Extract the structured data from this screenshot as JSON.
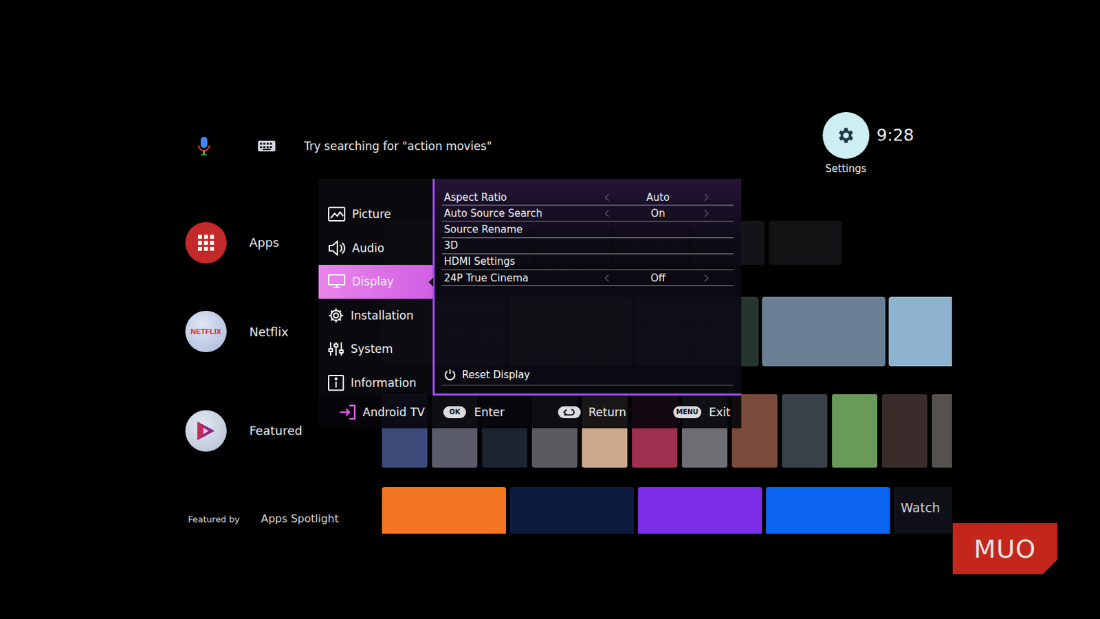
{
  "search": {
    "hint": "Try searching for \"action movies\""
  },
  "settings_button": {
    "label": "Settings"
  },
  "clock": {
    "time": "9:28"
  },
  "sidebar": {
    "items": [
      {
        "label": "Apps",
        "kind": "apps"
      },
      {
        "label": "Netflix",
        "kind": "netflix",
        "badge": "NETFLIX"
      },
      {
        "label": "Featured",
        "kind": "featured"
      }
    ]
  },
  "featured_by": {
    "label": "Featured by",
    "source": "Apps Spotlight"
  },
  "app_tiles": {
    "overflow_label": "Watch"
  },
  "settings_menu": {
    "categories": [
      {
        "label": "Picture",
        "selected": false
      },
      {
        "label": "Audio",
        "selected": false
      },
      {
        "label": "Display",
        "selected": true
      },
      {
        "label": "Installation",
        "selected": false
      },
      {
        "label": "System",
        "selected": false
      },
      {
        "label": "Information",
        "selected": false
      }
    ],
    "options": [
      {
        "label": "Aspect Ratio",
        "kind": "select",
        "value": "Auto"
      },
      {
        "label": "Auto Source Search",
        "kind": "select",
        "value": "On"
      },
      {
        "label": "Source Rename",
        "kind": "link"
      },
      {
        "label": "3D",
        "kind": "link"
      },
      {
        "label": "HDMI Settings",
        "kind": "link"
      },
      {
        "label": "24P True Cinema",
        "kind": "select",
        "value": "Off"
      }
    ],
    "reset": {
      "label": "Reset Display"
    },
    "footer": {
      "source": "Android TV",
      "hints": [
        {
          "kind": "key",
          "key": "OK",
          "action": "Enter"
        },
        {
          "kind": "return",
          "action": "Return"
        },
        {
          "kind": "key",
          "key": "MENU",
          "action": "Exit"
        }
      ]
    }
  },
  "watermark": {
    "text": "MUO"
  }
}
